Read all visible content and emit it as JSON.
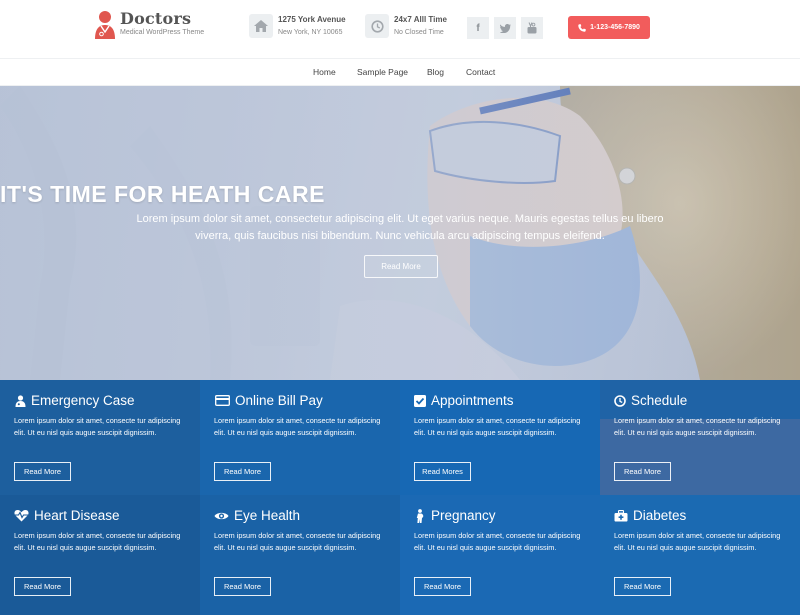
{
  "brand": {
    "title": "Doctors",
    "subtitle": "Medical WordPress Theme"
  },
  "header": {
    "address": {
      "line1": "1275 York Avenue",
      "line2": "New York, NY 10065"
    },
    "hours": {
      "line1": "24x7 Alll Time",
      "line2": "No Closed Time"
    },
    "social": [
      {
        "name": "facebook",
        "glyph": "f"
      },
      {
        "name": "twitter",
        "glyph": "t"
      },
      {
        "name": "youtube",
        "glyph": "▶"
      }
    ],
    "phone": "1-123-456-7890"
  },
  "nav": {
    "items": [
      "Home",
      "Sample Page",
      "Blog",
      "Contact"
    ]
  },
  "hero": {
    "title": "IT'S TIME FOR HEATH CARE",
    "text": "Lorem ipsum dolor sit amet, consectetur adipiscing elit. Ut eget varius neque. Mauris egestas tellus eu libero viverra, quis faucibus nisi bibendum. Nunc vehicula arcu adipiscing tempus eleifend.",
    "button": "Read More"
  },
  "services": [
    {
      "title": "Emergency Case",
      "icon": "doctor-icon",
      "text": "Lorem ipsum dolor sit amet, consecte tur adipiscing elit. Ut eu nisl quis augue suscipit dignissim.",
      "button": "Read More",
      "color": "#1d5f9e"
    },
    {
      "title": "Online Bill Pay",
      "icon": "credit-card-icon",
      "text": "Lorem ipsum dolor sit amet, consecte tur adipiscing elit. Ut eu nisl quis augue suscipit dignissim.",
      "button": "Read More",
      "color": "#1a66ad"
    },
    {
      "title": "Appointments",
      "icon": "checkbox-icon",
      "text": "Lorem ipsum dolor sit amet, consecte tur adipiscing elit. Ut eu nisl quis augue suscipit dignissim.",
      "button": "Read Mores",
      "color": "#1768b4"
    },
    {
      "title": "Schedule",
      "icon": "clock-icon",
      "text": "Lorem ipsum dolor sit amet, consecte tur adipiscing elit. Ut eu nisl quis augue suscipit dignissim.",
      "button": "Read More",
      "color": "#1f63a6"
    },
    {
      "title": "Heart Disease",
      "icon": "heartbeat-icon",
      "text": "Lorem ipsum dolor sit amet, consecte tur adipiscing elit. Ut eu nisl quis augue suscipit dignissim.",
      "button": "Read More",
      "color": "#1a5a98"
    },
    {
      "title": "Eye Health",
      "icon": "eye-icon",
      "text": "Lorem ipsum dolor sit amet, consecte tur adipiscing elit. Ut eu nisl quis augue suscipit dignissim.",
      "button": "Read More",
      "color": "#1a62a6"
    },
    {
      "title": "Pregnancy",
      "icon": "pregnancy-icon",
      "text": "Lorem ipsum dolor sit amet, consecte tur adipiscing elit. Ut eu nisl quis augue suscipit dignissim.",
      "button": "Read More",
      "color": "#1b69b4"
    },
    {
      "title": "Diabetes",
      "icon": "medkit-icon",
      "text": "Lorem ipsum dolor sit amet, consecte tur adipiscing elit. Ut eu nisl quis augue suscipit dignissim.",
      "button": "Read More",
      "color": "#1b6ab2"
    }
  ],
  "colors": {
    "phone_button": "#f25c5c",
    "service_blue": "#1a66ad"
  }
}
